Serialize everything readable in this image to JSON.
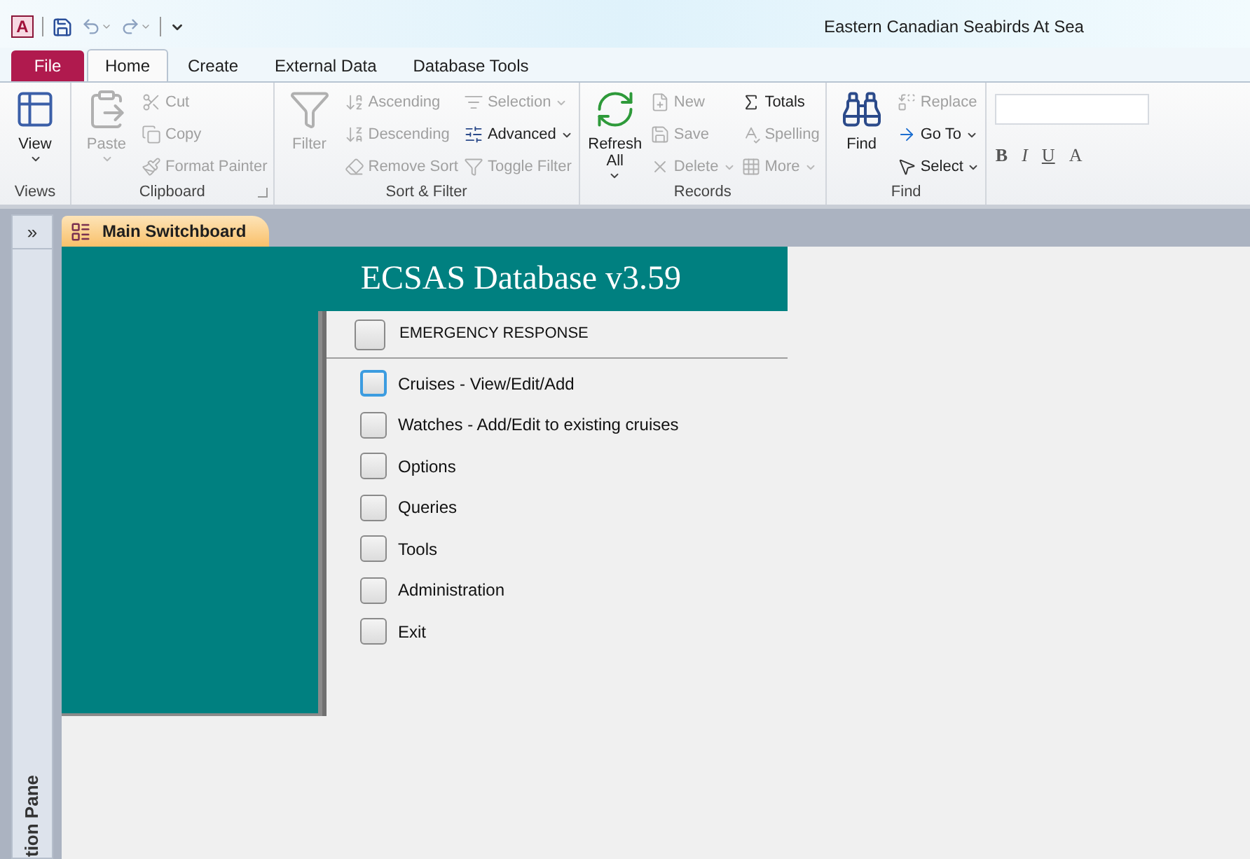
{
  "window": {
    "title": "Eastern Canadian Seabirds At Sea",
    "app_icon": "A"
  },
  "ribbon_tabs": [
    {
      "label": "File",
      "kind": "file",
      "selected": false
    },
    {
      "label": "Home",
      "kind": "tab",
      "selected": true
    },
    {
      "label": "Create",
      "kind": "tab",
      "selected": false
    },
    {
      "label": "External Data",
      "kind": "tab",
      "selected": false
    },
    {
      "label": "Database Tools",
      "kind": "tab",
      "selected": false
    }
  ],
  "ribbon_groups": [
    {
      "label": "Views",
      "launcher": false,
      "columns": [
        {
          "kind": "large",
          "label": "View",
          "disabled": false,
          "dropdown": true
        }
      ]
    },
    {
      "label": "Clipboard",
      "launcher": true,
      "columns": [
        {
          "kind": "large",
          "label": "Paste",
          "disabled": true,
          "dropdown": true
        },
        {
          "kind": "small",
          "items": [
            {
              "label": "Cut",
              "disabled": true,
              "dropdown": false
            },
            {
              "label": "Copy",
              "disabled": true,
              "dropdown": false
            },
            {
              "label": "Format Painter",
              "disabled": true,
              "dropdown": false
            }
          ]
        }
      ]
    },
    {
      "label": "Sort & Filter",
      "launcher": false,
      "columns": [
        {
          "kind": "large",
          "label": "Filter",
          "disabled": true,
          "dropdown": false
        },
        {
          "kind": "small",
          "items": [
            {
              "label": "Ascending",
              "disabled": true,
              "dropdown": false
            },
            {
              "label": "Descending",
              "disabled": true,
              "dropdown": false
            },
            {
              "label": "Remove Sort",
              "disabled": true,
              "dropdown": false
            }
          ]
        },
        {
          "kind": "small",
          "items": [
            {
              "label": "Selection",
              "disabled": true,
              "dropdown": true
            },
            {
              "label": "Advanced",
              "disabled": false,
              "dropdown": true
            },
            {
              "label": "Toggle Filter",
              "disabled": true,
              "dropdown": false
            }
          ]
        }
      ]
    },
    {
      "label": "Records",
      "launcher": false,
      "columns": [
        {
          "kind": "large",
          "label": "Refresh All",
          "disabled": false,
          "dropdown": true
        },
        {
          "kind": "small",
          "items": [
            {
              "label": "New",
              "disabled": true,
              "dropdown": false
            },
            {
              "label": "Save",
              "disabled": true,
              "dropdown": false
            },
            {
              "label": "Delete",
              "disabled": true,
              "dropdown": true
            }
          ]
        },
        {
          "kind": "small",
          "items": [
            {
              "label": "Totals",
              "disabled": false,
              "dropdown": false
            },
            {
              "label": "Spelling",
              "disabled": true,
              "dropdown": false
            },
            {
              "label": "More",
              "disabled": true,
              "dropdown": true
            }
          ]
        }
      ]
    },
    {
      "label": "Find",
      "launcher": false,
      "columns": [
        {
          "kind": "large",
          "label": "Find",
          "disabled": false,
          "dropdown": false
        },
        {
          "kind": "small",
          "items": [
            {
              "label": "Replace",
              "disabled": true,
              "dropdown": false
            },
            {
              "label": "Go To",
              "disabled": false,
              "dropdown": true
            },
            {
              "label": "Select",
              "disabled": false,
              "dropdown": true
            }
          ]
        }
      ]
    }
  ],
  "text_formatting": [
    {
      "label": "B",
      "kind": "bold"
    },
    {
      "label": "I",
      "kind": "italic"
    },
    {
      "label": "U",
      "kind": "underline"
    },
    {
      "label": "A",
      "kind": "plain"
    }
  ],
  "navigation_pane": {
    "toggle": "»",
    "label": "tion Pane"
  },
  "document_tabs": [
    {
      "label": "Main Switchboard",
      "selected": true
    }
  ],
  "switchboard": {
    "title": "ECSAS Database v3.59",
    "top_item": {
      "label": "EMERGENCY RESPONSE",
      "focused": false
    },
    "items": [
      {
        "label": "Cruises - View/Edit/Add",
        "focused": true
      },
      {
        "label": "Watches - Add/Edit to existing cruises",
        "focused": false
      },
      {
        "label": "Options",
        "focused": false
      },
      {
        "label": "Queries",
        "focused": false
      },
      {
        "label": "Tools",
        "focused": false
      },
      {
        "label": "Administration",
        "focused": false
      },
      {
        "label": "Exit",
        "focused": false
      }
    ]
  }
}
